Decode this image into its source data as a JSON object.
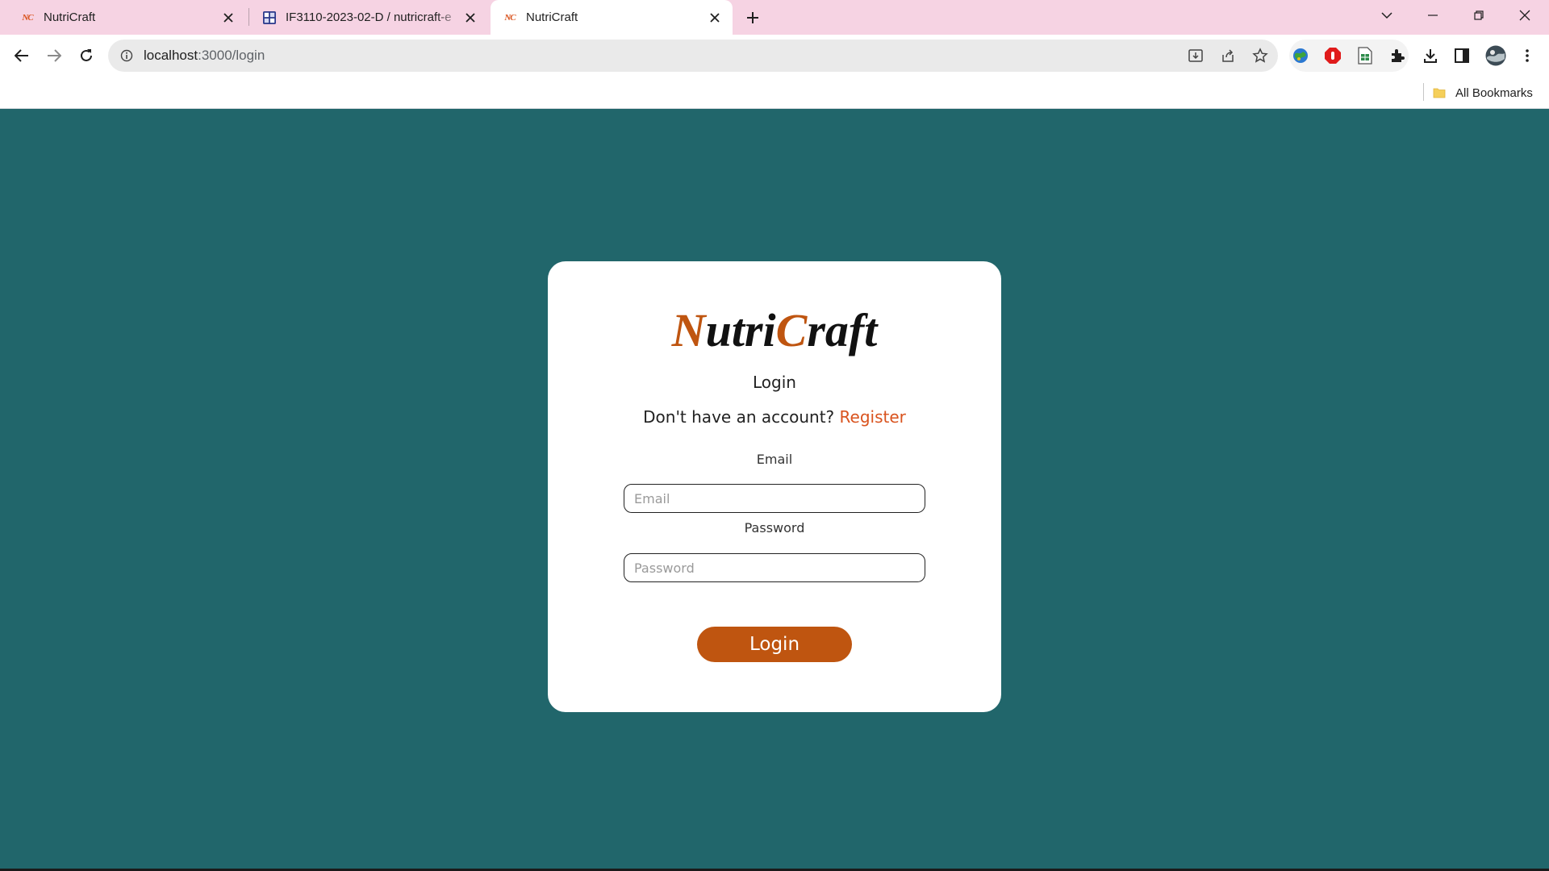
{
  "browser": {
    "tabs": [
      {
        "title": "NutriCraft",
        "favicon": "nutricraft-logo-icon",
        "active": false
      },
      {
        "title": "IF3110-2023-02-D / nutricraft-e",
        "favicon": "gitlab-project-icon",
        "active": false
      },
      {
        "title": "NutriCraft",
        "favicon": "nutricraft-logo-icon",
        "active": true
      }
    ],
    "favicon_text": "NC",
    "url_host": "localhost",
    "url_path": ":3000/login",
    "bookmarks": [
      {
        "label": "All Bookmarks",
        "icon": "folder-icon"
      }
    ],
    "colors": {
      "tabstrip": "#f6d3e3",
      "omnibox": "#eaeaea"
    }
  },
  "page": {
    "background": "#21666b",
    "logo": {
      "part1": "N",
      "part2": "utri",
      "part3": "C",
      "part4": "raft",
      "accent_color": "#bf5510"
    },
    "title": "Login",
    "register_prompt": "Don't have an account?",
    "register_link": "Register",
    "email": {
      "label": "Email",
      "placeholder": "Email",
      "value": ""
    },
    "password": {
      "label": "Password",
      "placeholder": "Password",
      "value": ""
    },
    "login_button": "Login"
  }
}
